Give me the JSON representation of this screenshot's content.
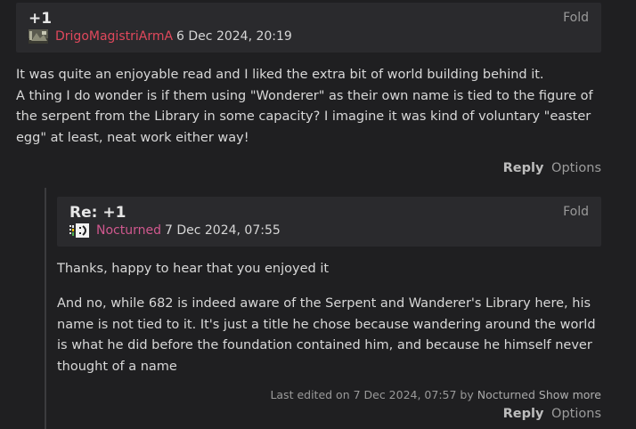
{
  "comments": [
    {
      "title": "+1",
      "fold_label": "Fold",
      "author": "DrigoMagistriArmA",
      "avatar_icon": "image-avatar-icon",
      "date": "6 Dec 2024, 20:19",
      "body": "It was quite an enjoyable read and I liked the extra bit of world building behind it.\nA thing I do wonder is if them using \"Wonderer\" as their own name is tied to the figure of the serpent from the Library in some capacity? I imagine it was kind of voluntary \"easter egg\" at least, neat work either way!",
      "reply_label": "Reply",
      "options_label": "Options"
    },
    {
      "title": "Re: +1",
      "fold_label": "Fold",
      "author": "Nocturned",
      "avatar_icon": "smiley-avatar-icon",
      "date": "7 Dec 2024, 07:55",
      "paragraphs": [
        "Thanks, happy to hear that you enjoyed it",
        "And no, while 682 is indeed aware of the Serpent and Wanderer's Library here, his name is not tied to it. It's just a title he chose because wandering around the world is what he did before the foundation contained him, and because he himself never thought of a name"
      ],
      "edited_prefix": "Last edited on 7 Dec 2024, 07:57 by",
      "edited_by": "Nocturned",
      "show_more_label": "Show more",
      "reply_label": "Reply",
      "options_label": "Options"
    }
  ],
  "colors": {
    "background": "#1f1f21",
    "header_bg": "#2a2a2d",
    "author_red": "#e0485c",
    "author_pink": "#d0588e"
  }
}
